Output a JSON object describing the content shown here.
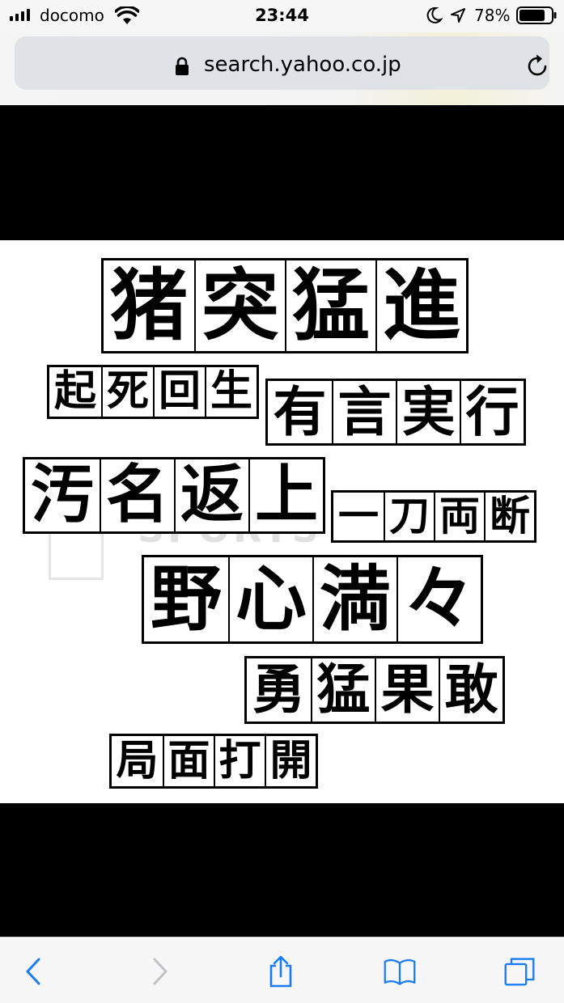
{
  "status_bar": {
    "carrier": "docomo",
    "time": "23:44",
    "battery_percent": "78%",
    "icons": [
      "signal-icon",
      "wifi-icon",
      "moon-icon",
      "location-arrow-icon",
      "battery-icon"
    ]
  },
  "address_bar": {
    "url": "search.yahoo.co.jp",
    "icons": [
      "lock-icon",
      "reload-icon"
    ]
  },
  "image": {
    "phrases": [
      "猪突猛進",
      "起死回生",
      "有言実行",
      "汚名返上",
      "一刀両断",
      "野心満々",
      "勇猛果敢",
      "局面打開"
    ],
    "watermark_text": "SPORTS TIRE"
  },
  "toolbar": {
    "icons": [
      "back-icon",
      "forward-icon",
      "share-icon",
      "bookmarks-icon",
      "tabs-icon"
    ],
    "accent_color": "#1a7cf5",
    "disabled_color": "#c2c2c6"
  },
  "colors": {
    "band": "#000000",
    "bar_background": "#f7f7f7",
    "urlbar_background": "#dfe2e6"
  }
}
